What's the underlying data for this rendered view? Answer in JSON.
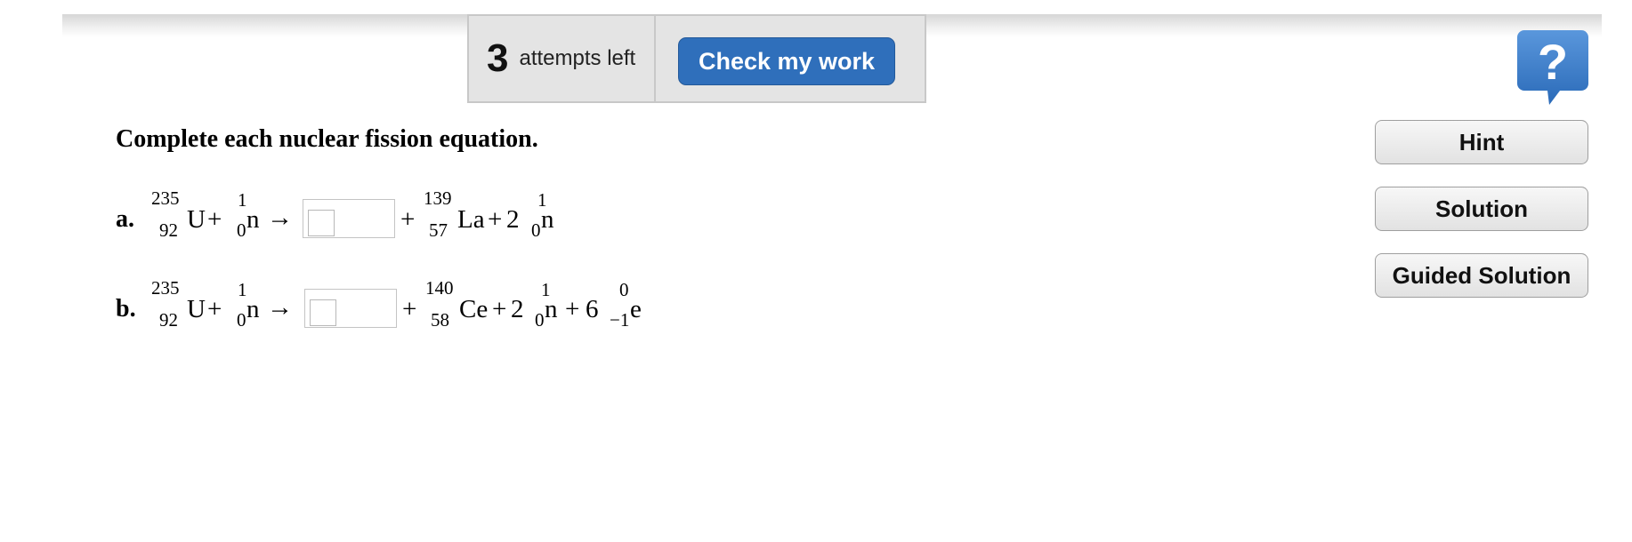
{
  "toolbar": {
    "attempts_count": "3",
    "attempts_text": "attempts left",
    "check_label": "Check my work",
    "help_symbol": "?",
    "help_icon": "question-speech-bubble-icon",
    "accent_color": "#2f6fbb"
  },
  "sidebar": {
    "hint_label": "Hint",
    "solution_label": "Solution",
    "guided_label": "Guided Solution"
  },
  "question": {
    "prompt": "Complete each nuclear fission equation."
  },
  "parts": {
    "a": {
      "label": "a.",
      "uranium": {
        "mass": "235",
        "atomic": "92",
        "symbol": "U"
      },
      "plus1": "+",
      "neutron": {
        "mass": "1",
        "atomic": "0",
        "symbol": "n"
      },
      "arrow": "→",
      "plus2": "+",
      "product": {
        "mass": "139",
        "atomic": "57",
        "symbol": "La"
      },
      "plus3": "+",
      "coef": "2",
      "neutron_out": {
        "mass": "1",
        "atomic": "0",
        "symbol": "n"
      }
    },
    "b": {
      "label": "b.",
      "uranium": {
        "mass": "235",
        "atomic": "92",
        "symbol": "U"
      },
      "plus1": "+",
      "neutron": {
        "mass": "1",
        "atomic": "0",
        "symbol": "n"
      },
      "arrow": "→",
      "plus2": "+",
      "product": {
        "mass": "140",
        "atomic": "58",
        "symbol": "Ce"
      },
      "plus3": "+",
      "coef": "2",
      "neutron_out": {
        "mass": "1",
        "atomic": "0",
        "symbol": "n"
      },
      "plus4": "+",
      "coef2": "6",
      "electron": {
        "mass": "0",
        "atomic": "−1",
        "symbol": "e"
      }
    }
  }
}
